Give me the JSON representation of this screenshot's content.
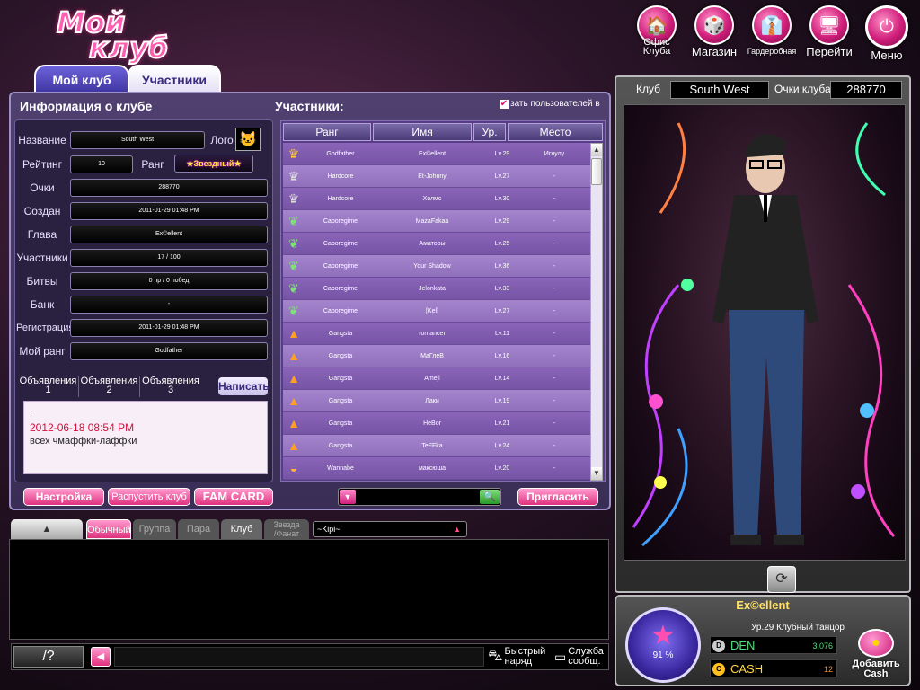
{
  "logo": {
    "line1": "Мой",
    "line2": "клуб"
  },
  "top_menu": [
    {
      "label": "Офис\nКлуба",
      "icon": "office-icon"
    },
    {
      "label": "Магазин",
      "icon": "shop-icon"
    },
    {
      "label": "Гардеробная",
      "icon": "wardrobe-icon"
    },
    {
      "label": "Перейти",
      "icon": "go-icon"
    },
    {
      "label": "Меню",
      "icon": "power-icon"
    }
  ],
  "tabs": {
    "my_club": "Мой клуб",
    "members": "Участники"
  },
  "info": {
    "title": "Информация о клубе",
    "logo_label": "Лого",
    "rank_label": "Ранг",
    "rank_value": "Звездный",
    "fields": [
      {
        "label": "Название",
        "value": "South West"
      },
      {
        "label": "Рейтинг",
        "value": "10"
      },
      {
        "label": "Очки",
        "value": "288770"
      },
      {
        "label": "Создан",
        "value": "2011-01-29 01:48 PM"
      },
      {
        "label": "Глава",
        "value": "Ex©ellent"
      },
      {
        "label": "Участники",
        "value": "17 / 100"
      },
      {
        "label": "Битвы",
        "value": "0 пр / 0 побед"
      },
      {
        "label": "Банк",
        "value": "-"
      },
      {
        "label": "Регистрация",
        "value": "2011-01-29 01:48 PM"
      },
      {
        "label": "Мой ранг",
        "value": "Godfather"
      }
    ]
  },
  "announcements": {
    "tabs": [
      "Объявления 1",
      "Объявления 2",
      "Объявления 3"
    ],
    "write": "Написать",
    "dot": ".",
    "date": "2012-06-18 08:54 PM",
    "text": "всех чмаффки-лаффки"
  },
  "members": {
    "title": "Участники:",
    "show_users": "зать пользователей в",
    "headers": [
      "Ранг",
      "Имя",
      "Ур.",
      "Место"
    ],
    "rows": [
      {
        "icon": "crown-gold-icon",
        "rank": "Godfather",
        "name": "Ex©ellent",
        "level": "Lv.29",
        "place": "Игнулу"
      },
      {
        "icon": "crown-silver-icon",
        "rank": "Hardcore",
        "name": "Et-Johnny",
        "level": "Lv.27",
        "place": "-"
      },
      {
        "icon": "crown-silver-icon",
        "rank": "Hardcore",
        "name": "Холмс",
        "level": "Lv.30",
        "place": "-"
      },
      {
        "icon": "wing-icon",
        "rank": "Caporegime",
        "name": "MazaFakaa",
        "level": "Lv.29",
        "place": "-"
      },
      {
        "icon": "wing-icon",
        "rank": "Caporegime",
        "name": "Аматоры",
        "level": "Lv.25",
        "place": "-"
      },
      {
        "icon": "wing-icon",
        "rank": "Caporegime",
        "name": "Your Shadow",
        "level": "Lv.36",
        "place": "-"
      },
      {
        "icon": "wing-icon",
        "rank": "Caporegime",
        "name": "Jelonkata",
        "level": "Lv.33",
        "place": "-"
      },
      {
        "icon": "wing-icon",
        "rank": "Caporegime",
        "name": "[Kel]",
        "level": "Lv.27",
        "place": "-"
      },
      {
        "icon": "cone-icon",
        "rank": "Gangsta",
        "name": "romancer",
        "level": "Lv.11",
        "place": "-"
      },
      {
        "icon": "cone-icon",
        "rank": "Gangsta",
        "name": "МаГлеВ",
        "level": "Lv.16",
        "place": "-"
      },
      {
        "icon": "cone-icon",
        "rank": "Gangsta",
        "name": "Amejl",
        "level": "Lv.14",
        "place": "-"
      },
      {
        "icon": "cone-icon",
        "rank": "Gangsta",
        "name": "Лаки",
        "level": "Lv.19",
        "place": "-"
      },
      {
        "icon": "cone-icon",
        "rank": "Gangsta",
        "name": "HeBor",
        "level": "Lv.21",
        "place": "-"
      },
      {
        "icon": "cone-icon",
        "rank": "Gangsta",
        "name": "TeFFka",
        "level": "Lv.24",
        "place": "-"
      },
      {
        "icon": "bowl-icon",
        "rank": "Wannabe",
        "name": "максюша",
        "level": "Lv.20",
        "place": "-"
      }
    ]
  },
  "buttons": {
    "settings": "Настройка",
    "disband": "Распустить клуб",
    "fam_card": "FAM CARD",
    "invite": "Пригласить"
  },
  "chat": {
    "tabs": [
      "Обычный",
      "Группа",
      "Пара",
      "Клуб",
      "Звезда\n/Фанат"
    ],
    "channel": "~Kipi~",
    "help": "/?",
    "quick_wear": "Быстрый\nнаряд",
    "service": "Служба\nсообщ."
  },
  "club_panel": {
    "club_label": "Клуб",
    "club_name": "South West",
    "points_label": "Очки клуба",
    "points": "288770"
  },
  "profile": {
    "name": "Ex©ellent",
    "level_line": "Ур.29  Клубный танцор",
    "level_percent": "91 %",
    "den_label": "DEN",
    "den_value": "3,076",
    "cash_label": "CASH",
    "cash_value": "12",
    "add_cash": "Добавить\nCash"
  }
}
